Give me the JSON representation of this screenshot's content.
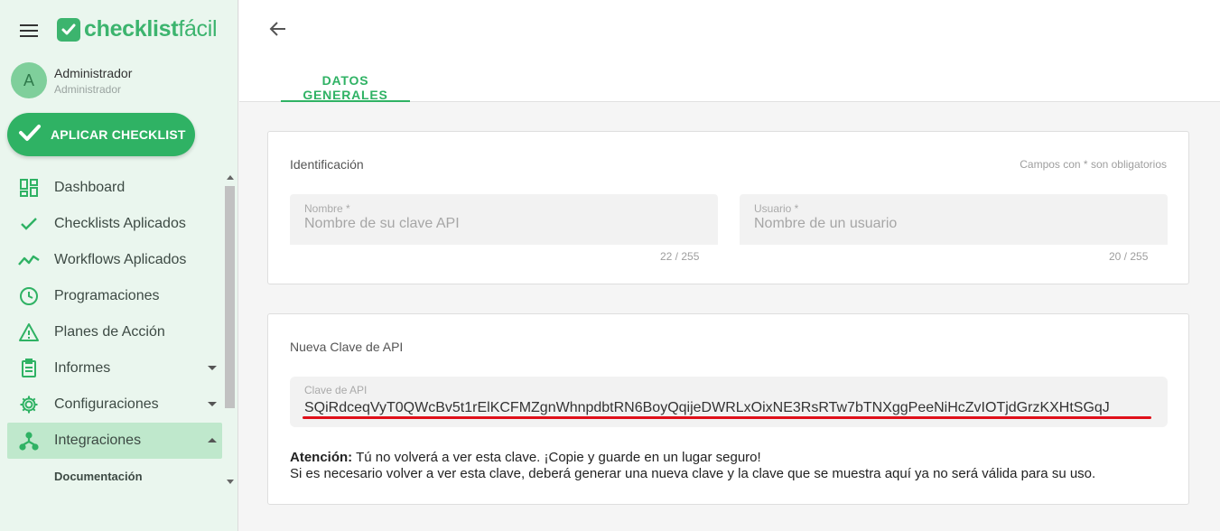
{
  "brand": {
    "name_bold": "checklist",
    "name_light": "fácil",
    "color": "#3cb46e"
  },
  "user": {
    "initial": "A",
    "name": "Administrador",
    "role": "Administrador"
  },
  "apply_button": {
    "label": "APLICAR CHECKLIST"
  },
  "nav": {
    "items": [
      {
        "label": "Dashboard",
        "icon": "dashboard-icon"
      },
      {
        "label": "Checklists Aplicados",
        "icon": "check-icon"
      },
      {
        "label": "Workflows Aplicados",
        "icon": "trend-icon"
      },
      {
        "label": "Programaciones",
        "icon": "clock-icon"
      },
      {
        "label": "Planes de Acción",
        "icon": "warning-icon"
      },
      {
        "label": "Informes",
        "icon": "report-icon"
      },
      {
        "label": "Configuraciones",
        "icon": "gear-icon"
      },
      {
        "label": "Integraciones",
        "icon": "integration-icon"
      }
    ],
    "sub_items": [
      {
        "label": "Documentación"
      }
    ]
  },
  "tabs": [
    {
      "label": "DATOS GENERALES",
      "active": true
    }
  ],
  "identification": {
    "title": "Identificación",
    "required_note": "Campos con * son obligatorios",
    "name_field": {
      "label": "Nombre *",
      "placeholder": "Nombre de su clave API",
      "counter": "22 / 255"
    },
    "user_field": {
      "label": "Usuario *",
      "placeholder": "Nombre de un usuario",
      "counter": "20 / 255"
    }
  },
  "api_key": {
    "title": "Nueva Clave de API",
    "field_label": "Clave de API",
    "value": "SQiRdceqVyT0QWcBv5t1rElKCFMZgnWhnpdbtRN6BoyQqijeDWRLxOixNE3RsRTw7bTNXggPeeNiHcZvIOTjdGrzKXHtSGqJ",
    "notice_bold": "Atención:",
    "notice_line1": "Tú no volverá a ver esta clave. ¡Copie y guarde en un lugar seguro!",
    "notice_line2": "Si es necesario volver a ver esta clave, deberá generar una nueva clave y la clave que se muestra aquí ya no será válida para su uso."
  },
  "colors": {
    "accent": "#2fb264",
    "sidebar_bg": "#eaf6ee",
    "active_bg": "#bfe8cc",
    "underline": "#e0101a"
  }
}
